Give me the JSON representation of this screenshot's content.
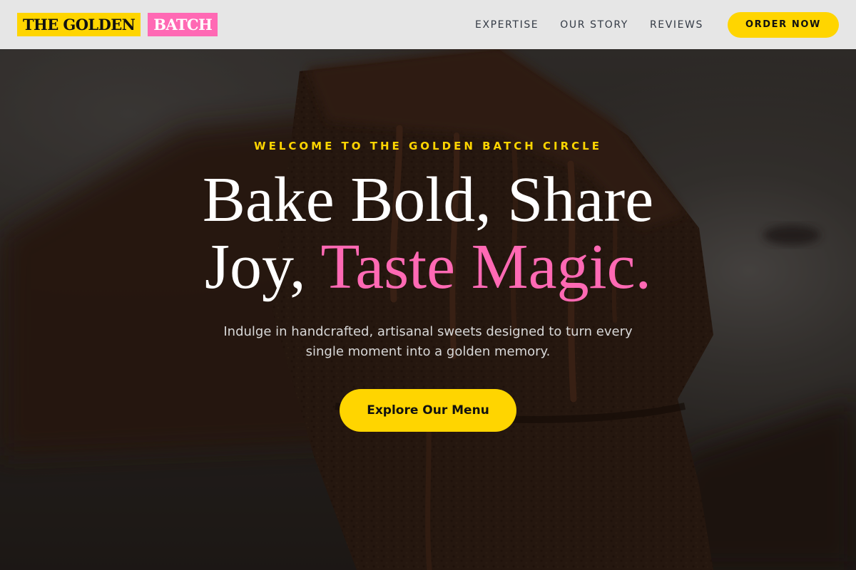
{
  "brand": {
    "part1": "THE GOLDEN",
    "part2": "BATCH"
  },
  "nav": {
    "items": [
      {
        "label": "EXPERTISE"
      },
      {
        "label": "OUR STORY"
      },
      {
        "label": "REVIEWS"
      }
    ],
    "cta_label": "ORDER NOW"
  },
  "hero": {
    "eyebrow": "WELCOME TO THE GOLDEN BATCH CIRCLE",
    "headline_line1": "Bake Bold, Share",
    "headline_line2_white": "Joy, ",
    "headline_line2_pink": "Taste Magic.",
    "subtext_line1": "Indulge in handcrafted, artisanal sweets designed to turn every",
    "subtext_line2": "single moment into a golden memory.",
    "cta_label": "Explore Our Menu",
    "background_icon": "chocolate-brownie-photo"
  },
  "colors": {
    "accent_gold": "#ffd500",
    "accent_pink": "#ff69b4",
    "header_bg": "#ececec",
    "nav_text": "#333a45"
  }
}
